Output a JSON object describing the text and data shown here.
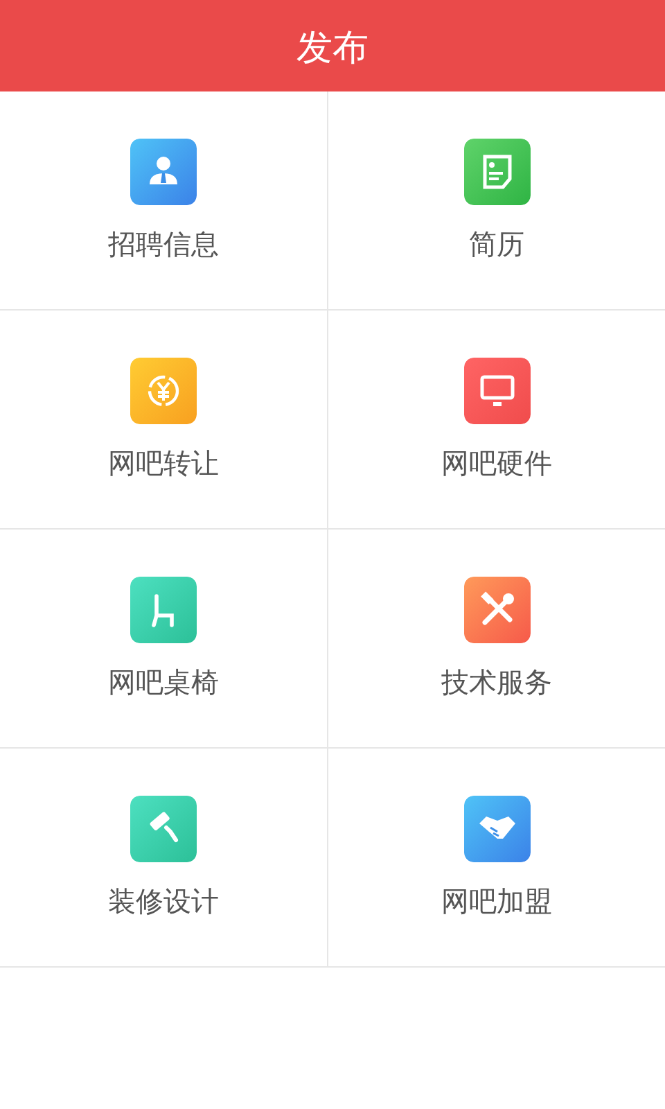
{
  "header": {
    "title": "发布"
  },
  "items": [
    {
      "label": "招聘信息"
    },
    {
      "label": "简历"
    },
    {
      "label": "网吧转让"
    },
    {
      "label": "网吧硬件"
    },
    {
      "label": "网吧桌椅"
    },
    {
      "label": "技术服务"
    },
    {
      "label": "装修设计"
    },
    {
      "label": "网吧加盟"
    }
  ]
}
